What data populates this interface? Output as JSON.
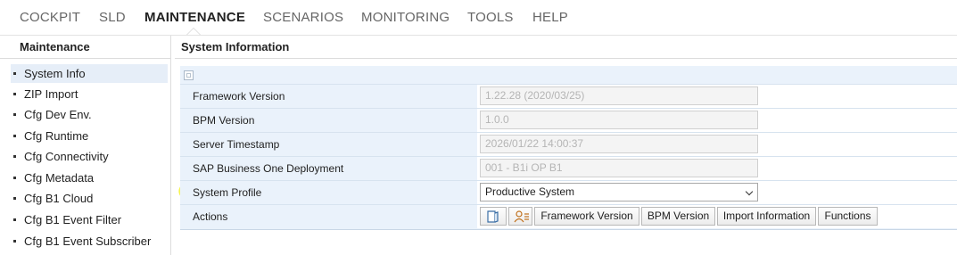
{
  "topnav": {
    "items": [
      "COCKPIT",
      "SLD",
      "MAINTENANCE",
      "SCENARIOS",
      "MONITORING",
      "TOOLS",
      "HELP"
    ],
    "active": "MAINTENANCE"
  },
  "sidebar": {
    "title": "Maintenance",
    "items": [
      {
        "label": "System Info",
        "selected": true
      },
      {
        "label": "ZIP Import"
      },
      {
        "label": "Cfg Dev Env."
      },
      {
        "label": "Cfg Runtime"
      },
      {
        "label": "Cfg Connectivity"
      },
      {
        "label": "Cfg Metadata"
      },
      {
        "label": "Cfg B1 Cloud"
      },
      {
        "label": "Cfg B1 Event Filter"
      },
      {
        "label": "Cfg B1 Event Subscriber"
      }
    ]
  },
  "main": {
    "title": "System Information",
    "rows": [
      {
        "label": "Framework Version",
        "value": "1.22.28 (2020/03/25)"
      },
      {
        "label": "BPM Version",
        "value": "1.0.0"
      },
      {
        "label": "Server Timestamp",
        "value": "2026/01/22 14:00:37"
      },
      {
        "label": "SAP Business One Deployment",
        "value": "001 - B1i OP B1"
      }
    ],
    "profile": {
      "label": "System Profile",
      "value": "Productive System"
    },
    "actions": {
      "label": "Actions",
      "icon_buttons": [
        "document-icon",
        "user-list-icon"
      ],
      "buttons": [
        "Framework Version",
        "BPM Version",
        "Import Information",
        "Functions"
      ]
    }
  },
  "colors": {
    "highlight": "#f4f24a",
    "panel_bg": "#eaf2fb"
  }
}
